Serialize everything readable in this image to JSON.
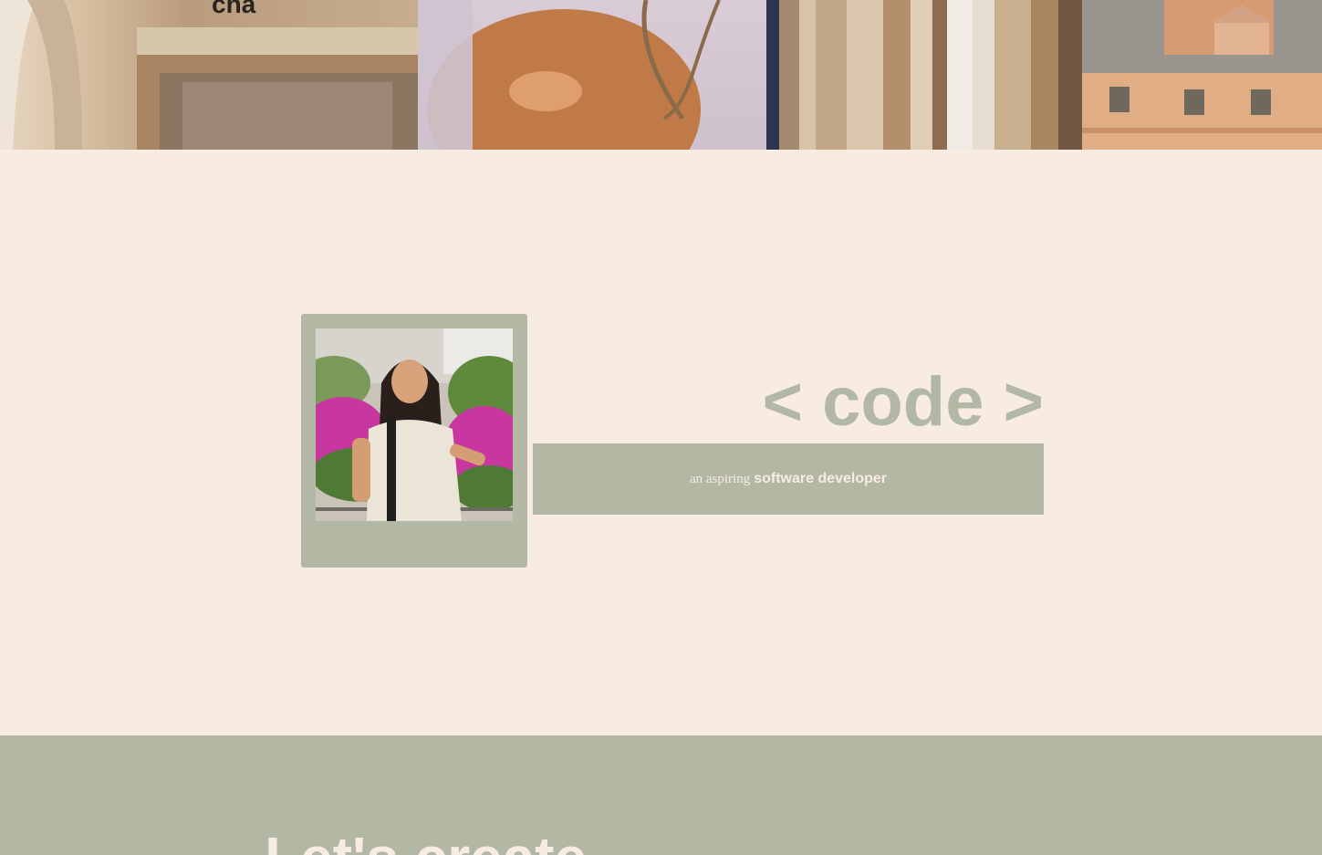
{
  "colors": {
    "background": "#f8ece2",
    "sage_accent": "#b2b8a4",
    "light_text": "#f8ece2"
  },
  "header_strip": {
    "tiles": [
      {
        "name": "storefront-photo"
      },
      {
        "name": "fruit-photo"
      },
      {
        "name": "bookshelf-photo"
      },
      {
        "name": "rooftop-photo"
      }
    ]
  },
  "hero": {
    "title": "< code >",
    "role_lead": "an aspiring",
    "role_strong": "software developer",
    "portrait_icon": "portrait-photo"
  },
  "bottom_section": {
    "heading": "Let's create"
  }
}
